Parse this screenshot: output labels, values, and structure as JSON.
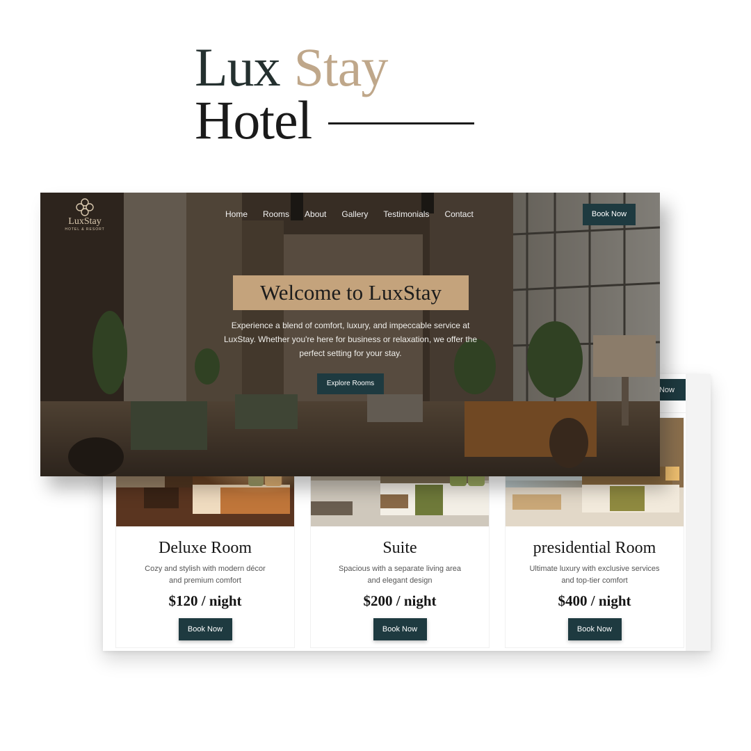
{
  "showcase": {
    "title_word1": "Lux",
    "title_word2": "Stay",
    "title_word3": "Hotel"
  },
  "brand": {
    "logo_name": "LuxStay",
    "logo_sub": "HOTEL & RESORT",
    "accent": "#c4a37c",
    "primary_button": "#1e3a40"
  },
  "nav": {
    "items": [
      {
        "label": "Home"
      },
      {
        "label": "Rooms"
      },
      {
        "label": "About"
      },
      {
        "label": "Gallery"
      },
      {
        "label": "Testimonials"
      },
      {
        "label": "Contact"
      }
    ],
    "book_label": "Book Now"
  },
  "hero": {
    "title": "Welcome to LuxStay",
    "text": "Experience a blend of comfort, luxury, and impeccable service at LuxStay. Whether you're here for business or relaxation, we offer the perfect setting for your stay.",
    "explore_label": "Explore Rooms"
  },
  "back_panel": {
    "button_label": "Now"
  },
  "rooms": [
    {
      "name": "Deluxe Room",
      "desc": "Cozy and stylish with modern décor and premium comfort",
      "price": "$120 / night",
      "button": "Book Now"
    },
    {
      "name": "Suite",
      "desc": "Spacious with a separate living area and elegant design",
      "price": "$200 / night",
      "button": "Book Now"
    },
    {
      "name": "presidential Room",
      "desc": "Ultimate luxury with exclusive services and top-tier comfort",
      "price": "$400 / night",
      "button": "Book Now"
    }
  ]
}
